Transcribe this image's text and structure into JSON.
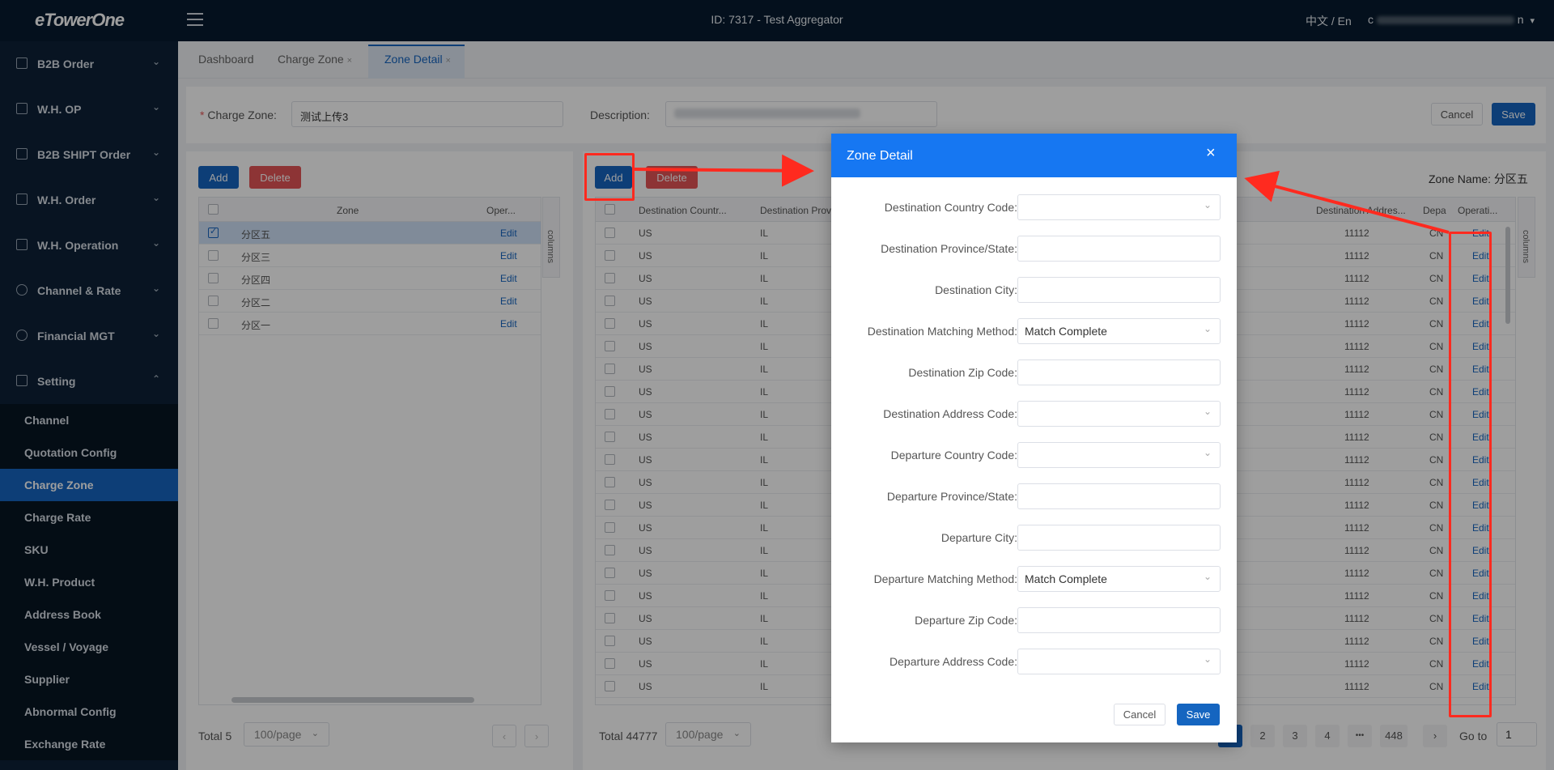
{
  "header": {
    "logo": "eTowerOne",
    "title": "ID: 7317 - Test Aggregator",
    "lang": "中文 / En",
    "user_prefix": "c",
    "user_suffix": "n"
  },
  "sidebar": {
    "groups": [
      {
        "label": "B2B Order"
      },
      {
        "label": "W.H. OP"
      },
      {
        "label": "B2B SHIPT Order"
      },
      {
        "label": "W.H. Order"
      },
      {
        "label": "W.H. Operation"
      },
      {
        "label": "Channel & Rate"
      },
      {
        "label": "Financial MGT"
      },
      {
        "label": "Setting"
      }
    ],
    "sub_items": [
      {
        "label": "Channel"
      },
      {
        "label": "Quotation Config"
      },
      {
        "label": "Charge Zone"
      },
      {
        "label": "Charge Rate"
      },
      {
        "label": "SKU"
      },
      {
        "label": "W.H. Product"
      },
      {
        "label": "Address Book"
      },
      {
        "label": "Vessel / Voyage"
      },
      {
        "label": "Supplier"
      },
      {
        "label": "Abnormal Config"
      },
      {
        "label": "Exchange Rate"
      }
    ]
  },
  "tabs": [
    {
      "label": "Dashboard"
    },
    {
      "label": "Charge Zone"
    },
    {
      "label": "Zone Detail"
    }
  ],
  "form": {
    "charge_zone_label": "Charge Zone:",
    "charge_zone_value": "测试上传3",
    "description_label": "Description:",
    "cancel": "Cancel",
    "save": "Save"
  },
  "left_panel": {
    "add": "Add",
    "delete": "Delete",
    "col_zone": "Zone",
    "col_oper": "Oper...",
    "side_tab": "columns",
    "rows": [
      {
        "zone": "分区五",
        "action": "Edit"
      },
      {
        "zone": "分区三",
        "action": "Edit"
      },
      {
        "zone": "分区四",
        "action": "Edit"
      },
      {
        "zone": "分区二",
        "action": "Edit"
      },
      {
        "zone": "分区一",
        "action": "Edit"
      }
    ],
    "total": "Total 5",
    "page_size": "100/page"
  },
  "right_panel": {
    "add": "Add",
    "delete": "Delete",
    "zone_name": "Zone Name:  分区五",
    "col_country": "Destination Countr...",
    "col_province": "Destination Provi",
    "col_address": "Destination Addres...",
    "col_dep": "Depa",
    "col_oper": "Operati...",
    "side_tab": "columns",
    "row_country": "US",
    "row_province": "IL",
    "row_address": "11112",
    "row_dep": "CN",
    "row_action": "Edit",
    "total": "Total 44777",
    "page_size": "100/page",
    "pages": [
      "1",
      "2",
      "3",
      "4",
      "•••",
      "448"
    ],
    "goto": "Go to",
    "goto_value": "1"
  },
  "dialog": {
    "title": "Zone Detail",
    "close": "×",
    "fields": [
      {
        "label": "Destination Country Code:",
        "value": "",
        "type": "select"
      },
      {
        "label": "Destination Province/State:",
        "value": "",
        "type": "input"
      },
      {
        "label": "Destination City:",
        "value": "",
        "type": "input"
      },
      {
        "label": "Destination Matching Method:",
        "value": "Match Complete",
        "type": "select"
      },
      {
        "label": "Destination Zip Code:",
        "value": "",
        "type": "input"
      },
      {
        "label": "Destination Address Code:",
        "value": "",
        "type": "select"
      },
      {
        "label": "Departure Country Code:",
        "value": "",
        "type": "select"
      },
      {
        "label": "Departure Province/State:",
        "value": "",
        "type": "input"
      },
      {
        "label": "Departure City:",
        "value": "",
        "type": "input"
      },
      {
        "label": "Departure Matching Method:",
        "value": "Match Complete",
        "type": "select"
      },
      {
        "label": "Departure Zip Code:",
        "value": "",
        "type": "input"
      },
      {
        "label": "Departure Address Code:",
        "value": "",
        "type": "select"
      }
    ],
    "cancel": "Cancel",
    "save": "Save"
  },
  "colors": {
    "primary": "#1565c0",
    "dialog_header": "#1677f2",
    "danger": "#e45456",
    "annotation": "#ff2a1f"
  }
}
